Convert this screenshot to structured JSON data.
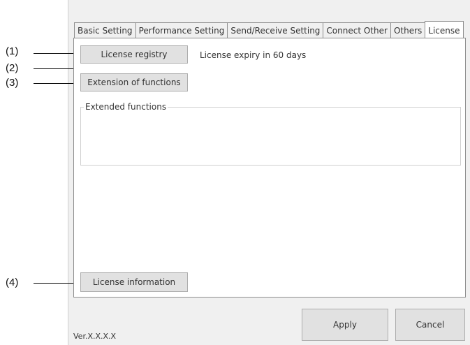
{
  "tabs": [
    "Basic Setting",
    "Performance Setting",
    "Send/Receive Setting",
    "Connect Other",
    "Others",
    "License"
  ],
  "license": {
    "registry_button": "License registry",
    "expiry_text": "License expiry in 60 days",
    "extension_button": "Extension of functions",
    "extended_group_label": "Extended functions",
    "info_button": "License information"
  },
  "footer": {
    "apply_button": "Apply",
    "cancel_button": "Cancel",
    "version": "Ver.X.X.X.X"
  },
  "callouts": [
    "(1)",
    "(2)",
    "(3)",
    "(4)"
  ]
}
